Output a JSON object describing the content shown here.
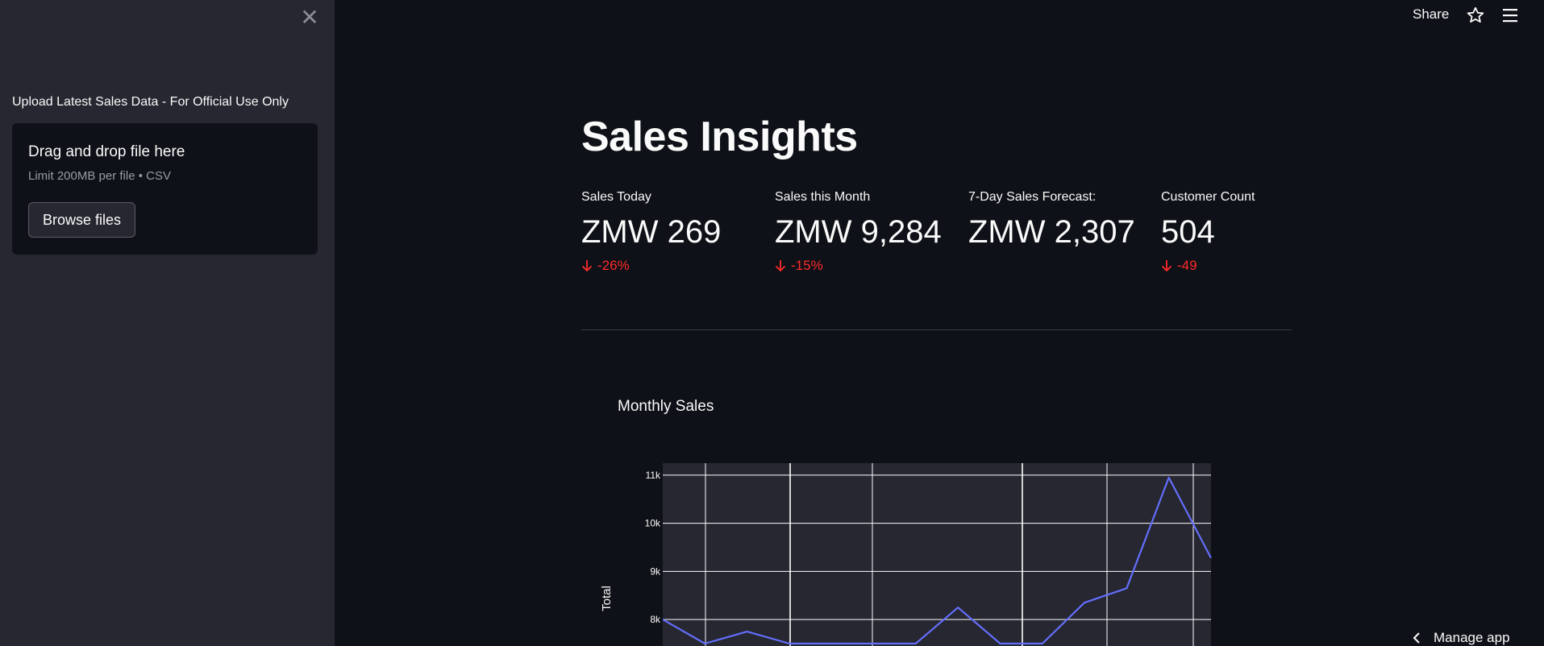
{
  "sidebar": {
    "close_icon": "close-icon",
    "upload_label": "Upload Latest Sales Data - For Official Use Only",
    "dropzone": {
      "title": "Drag and drop file here",
      "limit": "Limit 200MB per file • CSV",
      "browse_label": "Browse files"
    }
  },
  "header": {
    "share_label": "Share",
    "star_icon": "star-icon",
    "menu_icon": "hamburger-menu-icon"
  },
  "main": {
    "title": "Sales Insights",
    "metrics": [
      {
        "label": "Sales Today",
        "value": "ZMW 269",
        "delta": "-26%"
      },
      {
        "label": "Sales this Month",
        "value": "ZMW 9,284",
        "delta": "-15%"
      },
      {
        "label": "7-Day Sales Forecast:",
        "value": "ZMW 2,307",
        "delta": ""
      },
      {
        "label": "Customer Count",
        "value": "504",
        "delta": "-49"
      }
    ],
    "chart_title": "Monthly Sales"
  },
  "footer": {
    "manage_label": "Manage app"
  },
  "colors": {
    "background": "#0e1117",
    "sidebar": "#262730",
    "delta_negative": "#ff2b2b",
    "line": "#636efa",
    "plot_bg": "#262730"
  },
  "chart_data": {
    "type": "line",
    "title": "Monthly Sales",
    "ylabel": "Total",
    "xlabel": "",
    "y_ticks": [
      "8k",
      "9k",
      "10k",
      "11k"
    ],
    "ylim": [
      7450,
      11250
    ],
    "x": [
      0,
      1,
      2,
      3,
      4,
      5,
      6,
      7,
      8,
      9,
      10,
      11,
      12,
      13
    ],
    "values": [
      8000,
      7500,
      7750,
      7500,
      7500,
      7500,
      7500,
      8250,
      7500,
      7500,
      8350,
      8650,
      10950,
      9280
    ],
    "grid": true
  }
}
